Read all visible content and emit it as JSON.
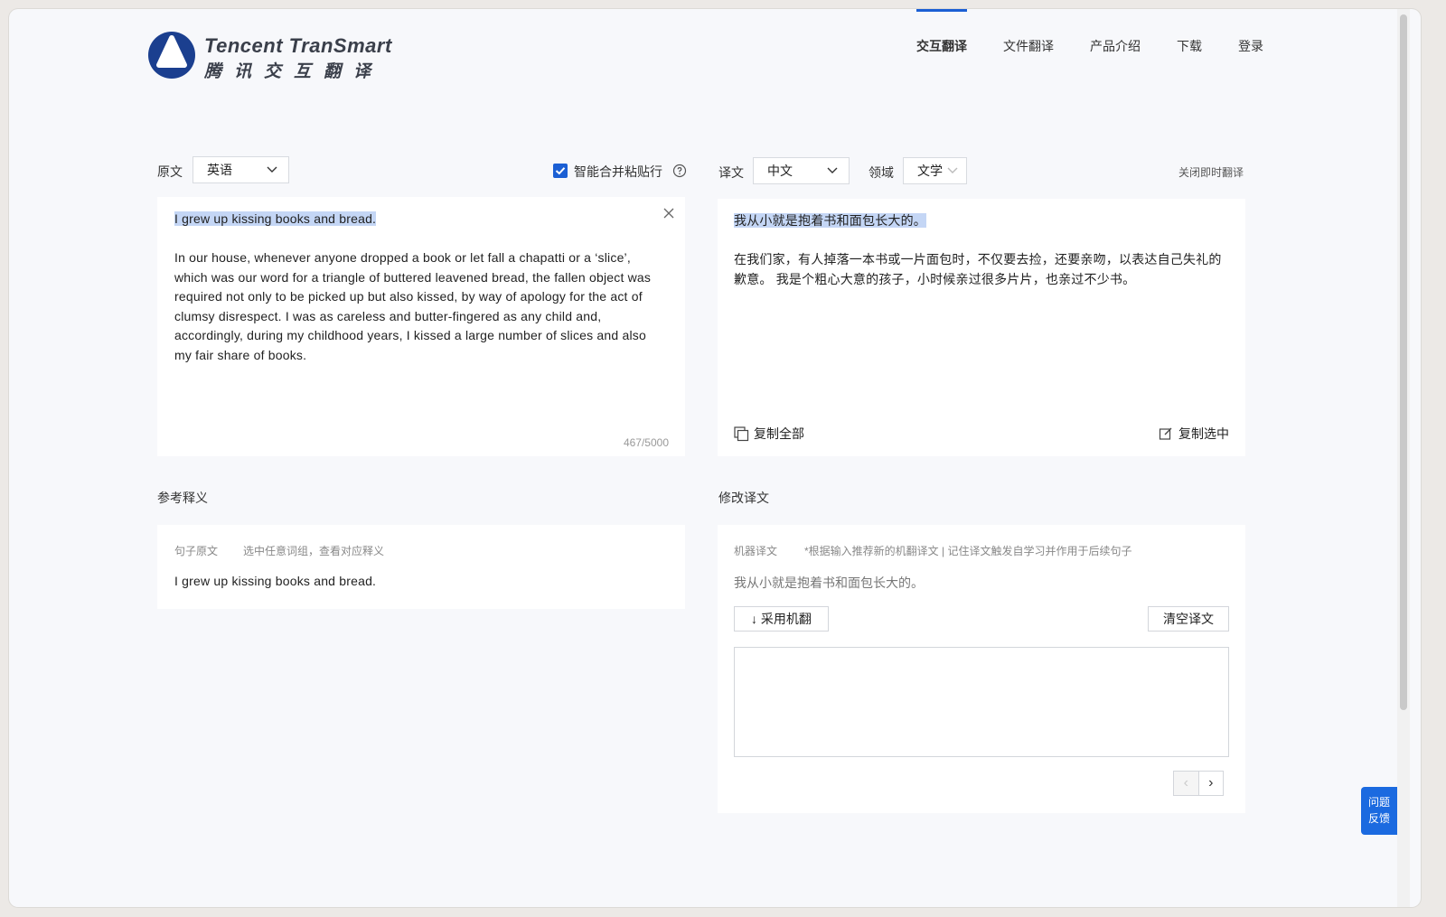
{
  "app": {
    "logo_en": "Tencent TranSmart",
    "logo_cn": "腾讯交互翻译",
    "brand_color": "#1b5fd4"
  },
  "nav": {
    "items": [
      "交互翻译",
      "文件翻译",
      "产品介绍",
      "下载",
      "登录"
    ],
    "active": "交互翻译"
  },
  "source": {
    "label": "原文",
    "language": "英语",
    "smart_merge_label": "智能合并粘贴行",
    "smart_merge_checked": true,
    "highlighted_sentence": "I grew up kissing books and bread.",
    "paragraph": "In our house, whenever anyone dropped a book or let fall a chapatti or a ‘slice’, which was our word for a triangle of buttered leavened bread, the fallen object was required not only to be picked up but also kissed, by way of apology for the act of clumsy disrespect. I was as careless and butter-fingered as any child and, accordingly, during my childhood years, I kissed a large number of slices and also my fair share of books.",
    "char_count": "467/5000"
  },
  "target": {
    "label": "译文",
    "language": "中文",
    "domain_label": "领域",
    "domain": "文学",
    "toggle_instant": "关闭即时翻译",
    "highlighted_sentence": "我从小就是抱着书和面包长大的。",
    "paragraph": "在我们家，有人掉落一本书或一片面包时，不仅要去捡，还要亲吻，以表达自己失礼的歉意。 我是个粗心大意的孩子，小时候亲过很多片片，也亲过不少书。",
    "copy_all": "复制全部",
    "copy_selected": "复制选中"
  },
  "reference": {
    "title": "参考释义",
    "col_sentence": "句子原文",
    "col_hint": "选中任意词组，查看对应释义",
    "sentence": "I grew up kissing books and bread."
  },
  "revise": {
    "title": "修改译文",
    "machine_label": "机器译文",
    "machine_hint": "*根据输入推荐新的机翻译文 | 记住译文触发自学习并作用于后续句子",
    "machine_text": "我从小就是抱着书和面包长大的。",
    "adopt_button": "↓ 采用机翻",
    "clear_button": "清空译文",
    "edit_value": "",
    "prev": "‹",
    "next": "›"
  },
  "feedback": {
    "line1": "问题",
    "line2": "反馈"
  }
}
